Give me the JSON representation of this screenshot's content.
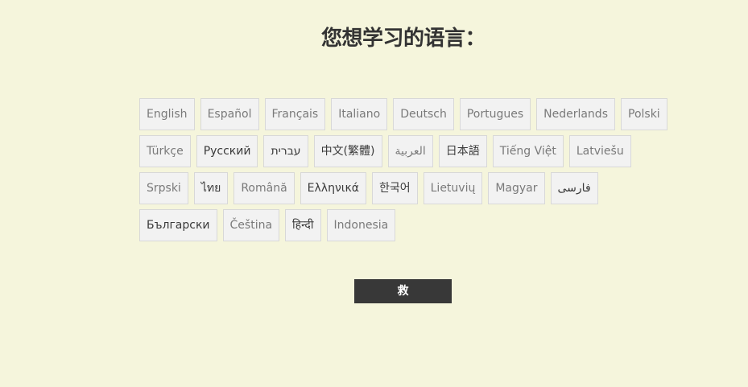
{
  "title": "您想学习的语言：",
  "languages": [
    [
      "English",
      "Español",
      "Français",
      "Italiano",
      "Deutsch",
      "Portugues",
      "Nederlands",
      "Polski"
    ],
    [
      "Türkçe",
      "Русский",
      "עברית",
      "中文(繁體)",
      "العربية",
      "日本語",
      "Tiếng Việt",
      "Latviešu"
    ],
    [
      "Srpski",
      "ไทย",
      "Română",
      "Ελληνικά",
      "한국어",
      "Lietuvių",
      "Magyar",
      "فارسی"
    ],
    [
      "Български",
      "Čeština",
      "हिन्दी",
      "Indonesia"
    ]
  ],
  "save_label": "救"
}
